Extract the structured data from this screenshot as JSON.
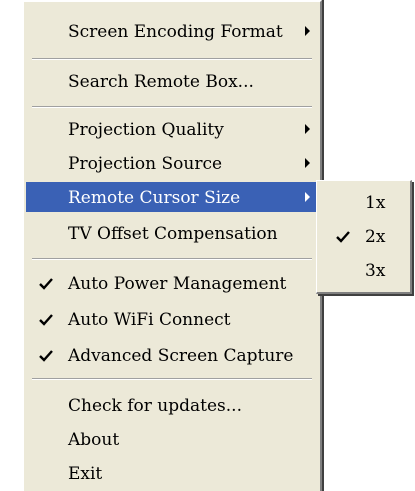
{
  "menu": {
    "items": [
      {
        "label": "Screen Encoding Format",
        "submenu": true
      },
      {
        "label": "Search Remote Box..."
      },
      {
        "label": "Projection Quality",
        "submenu": true
      },
      {
        "label": "Projection Source",
        "submenu": true
      },
      {
        "label": "Remote Cursor Size",
        "submenu": true,
        "selected": true
      },
      {
        "label": "TV Offset Compensation"
      },
      {
        "label": "Auto Power Management",
        "checked": true
      },
      {
        "label": "Auto WiFi Connect",
        "checked": true
      },
      {
        "label": "Advanced Screen Capture",
        "checked": true
      },
      {
        "label": "Check for updates..."
      },
      {
        "label": "About"
      },
      {
        "label": "Exit"
      }
    ]
  },
  "submenu": {
    "items": [
      {
        "label": "1x"
      },
      {
        "label": "2x",
        "checked": true
      },
      {
        "label": "3x"
      }
    ]
  },
  "colors": {
    "menu_background": "#ece9d8",
    "highlight": "#3a61b5",
    "highlight_text": "#ffffff"
  }
}
